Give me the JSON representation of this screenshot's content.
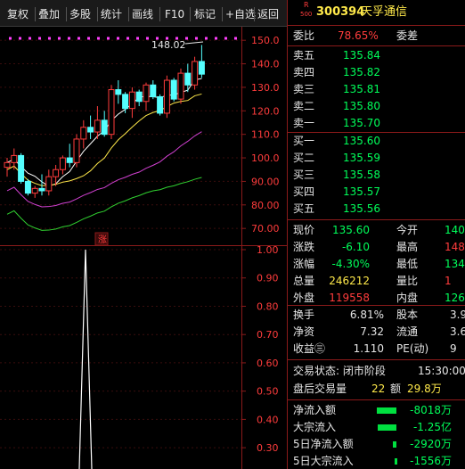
{
  "toolbar": {
    "buttons": [
      "复权",
      "叠加",
      "多股",
      "统计",
      "画线",
      "F10",
      "标记",
      "+自选",
      "返回"
    ]
  },
  "chart": {
    "price_axis": [
      "150.0",
      "140.0",
      "130.0",
      "120.0",
      "110.0",
      "100.0",
      "90.00",
      "80.00",
      "70.00"
    ],
    "indicator_axis": [
      "1.00",
      "0.90",
      "0.80",
      "0.70",
      "0.60",
      "0.50",
      "0.40",
      "0.30"
    ],
    "high_label": "148.02",
    "badge": "涨"
  },
  "chart_data": {
    "type": "candlestick",
    "ylim": [
      64,
      155
    ],
    "ohlc": [
      [
        96,
        100,
        92,
        98
      ],
      [
        98,
        104,
        95,
        101
      ],
      [
        101,
        102,
        89,
        90
      ],
      [
        90,
        91,
        84,
        85
      ],
      [
        85,
        88,
        83,
        87
      ],
      [
        87,
        93,
        84,
        86
      ],
      [
        86,
        95,
        84,
        92
      ],
      [
        92,
        97,
        88,
        95
      ],
      [
        95,
        101,
        93,
        100
      ],
      [
        100,
        106,
        96,
        98
      ],
      [
        98,
        110,
        96,
        108
      ],
      [
        108,
        116,
        104,
        113
      ],
      [
        113,
        118,
        108,
        111
      ],
      [
        111,
        122,
        108,
        116
      ],
      [
        116,
        120,
        109,
        110
      ],
      [
        110,
        131,
        108,
        129
      ],
      [
        129,
        133,
        123,
        127
      ],
      [
        127,
        128,
        119,
        121
      ],
      [
        121,
        130,
        117,
        128
      ],
      [
        128,
        129,
        122,
        124
      ],
      [
        124,
        132,
        120,
        131
      ],
      [
        131,
        133,
        125,
        126
      ],
      [
        126,
        127,
        118,
        119
      ],
      [
        119,
        135,
        117,
        133
      ],
      [
        133,
        134,
        124,
        125
      ],
      [
        125,
        138,
        123,
        136
      ],
      [
        136,
        140,
        128,
        131
      ],
      [
        131,
        143,
        129,
        141
      ],
      [
        141,
        148.02,
        134,
        135.6
      ]
    ],
    "indicator": [
      0.05,
      0.05,
      0.05,
      0.05,
      0.05,
      0.05,
      0.05,
      0.05,
      0.05,
      0.05,
      0.05,
      0.05,
      0.05,
      0.05,
      0.05,
      0.05,
      0.05,
      0.05,
      0.05,
      0.05,
      0.05,
      0.05,
      0.05,
      0.05,
      1.0,
      0.05,
      0.05,
      0.05,
      0.05
    ]
  },
  "quote": {
    "code": "300394",
    "name": "天孚通信",
    "rz_top": "R",
    "rz_bottom": "500",
    "webi_label": "委比",
    "webi_value": "78.65%",
    "wecha_label": "委差",
    "asks": [
      {
        "label": "卖五",
        "price": "135.84"
      },
      {
        "label": "卖四",
        "price": "135.82"
      },
      {
        "label": "卖三",
        "price": "135.81"
      },
      {
        "label": "卖二",
        "price": "135.80"
      },
      {
        "label": "卖一",
        "price": "135.70"
      }
    ],
    "bids": [
      {
        "label": "买一",
        "price": "135.60"
      },
      {
        "label": "买二",
        "price": "135.59"
      },
      {
        "label": "买三",
        "price": "135.58"
      },
      {
        "label": "买四",
        "price": "135.57"
      },
      {
        "label": "买五",
        "price": "135.56"
      }
    ],
    "stats": [
      {
        "l1": "现价",
        "v1": "135.60",
        "c1": "green",
        "l2": "今开",
        "v2": "140",
        "c2": "green"
      },
      {
        "l1": "涨跌",
        "v1": "-6.10",
        "c1": "green",
        "l2": "最高",
        "v2": "148",
        "c2": "red"
      },
      {
        "l1": "涨幅",
        "v1": "-4.30%",
        "c1": "green",
        "l2": "最低",
        "v2": "134",
        "c2": "green"
      },
      {
        "l1": "总量",
        "v1": "246212",
        "c1": "yellow",
        "l2": "量比",
        "v2": "1",
        "c2": "red"
      },
      {
        "l1": "外盘",
        "v1": "119558",
        "c1": "red",
        "l2": "内盘",
        "v2": "126",
        "c2": "green"
      }
    ],
    "stats2": [
      {
        "l1": "换手",
        "v1": "6.81%",
        "l2": "股本",
        "v2": "3.9"
      },
      {
        "l1": "净资",
        "v1": "7.32",
        "l2": "流通",
        "v2": "3.6"
      },
      {
        "l1": "收益㊂",
        "v1": "1.110",
        "l2": "PE(动)",
        "v2": "9"
      }
    ],
    "trade_status": "交易状态: 闭市阶段",
    "trade_time": "15:30:00",
    "after_hours_label": "盘后交易量",
    "after_hours_volume": "22",
    "after_hours_amount_label": "额",
    "after_hours_amount": "29.8万",
    "flows": [
      {
        "label": "净流入额",
        "value": "-8018万"
      },
      {
        "label": "大宗流入",
        "value": "-1.25亿"
      },
      {
        "label": "5日净流入额",
        "value": "-2920万"
      },
      {
        "label": "5日大宗流入",
        "value": "-1556万"
      }
    ],
    "flow_bar_fraction": [
      1.0,
      0.95,
      0.2,
      0.1
    ],
    "colors": {
      "up": "#ff3c3c",
      "down": "#00ff5a",
      "volume": "#ffe94a",
      "accent": "#8b1a1a"
    }
  }
}
